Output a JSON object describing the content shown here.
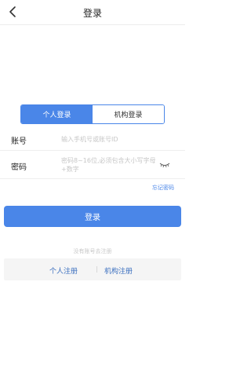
{
  "header": {
    "title": "登录",
    "back_icon": "chevron-left-icon"
  },
  "tabs": [
    {
      "label": "个人登录",
      "active": true
    },
    {
      "label": "机构登录",
      "active": false
    }
  ],
  "form": {
    "account": {
      "label": "账号",
      "placeholder": "输入手机号或账号ID"
    },
    "password": {
      "label": "密码",
      "placeholder": "密码8~16位,必须包含大小写字母+数字",
      "toggle_icon": "eye-closed-icon"
    }
  },
  "forgot_password": "忘记密码",
  "login_button": "登录",
  "register": {
    "hint": "没有账号去注册",
    "personal": "个人注册",
    "separator": "|",
    "organization": "机构注册"
  },
  "colors": {
    "accent": "#4a86e8",
    "register_text": "#3b6fbf",
    "placeholder": "#c7c7c7"
  }
}
